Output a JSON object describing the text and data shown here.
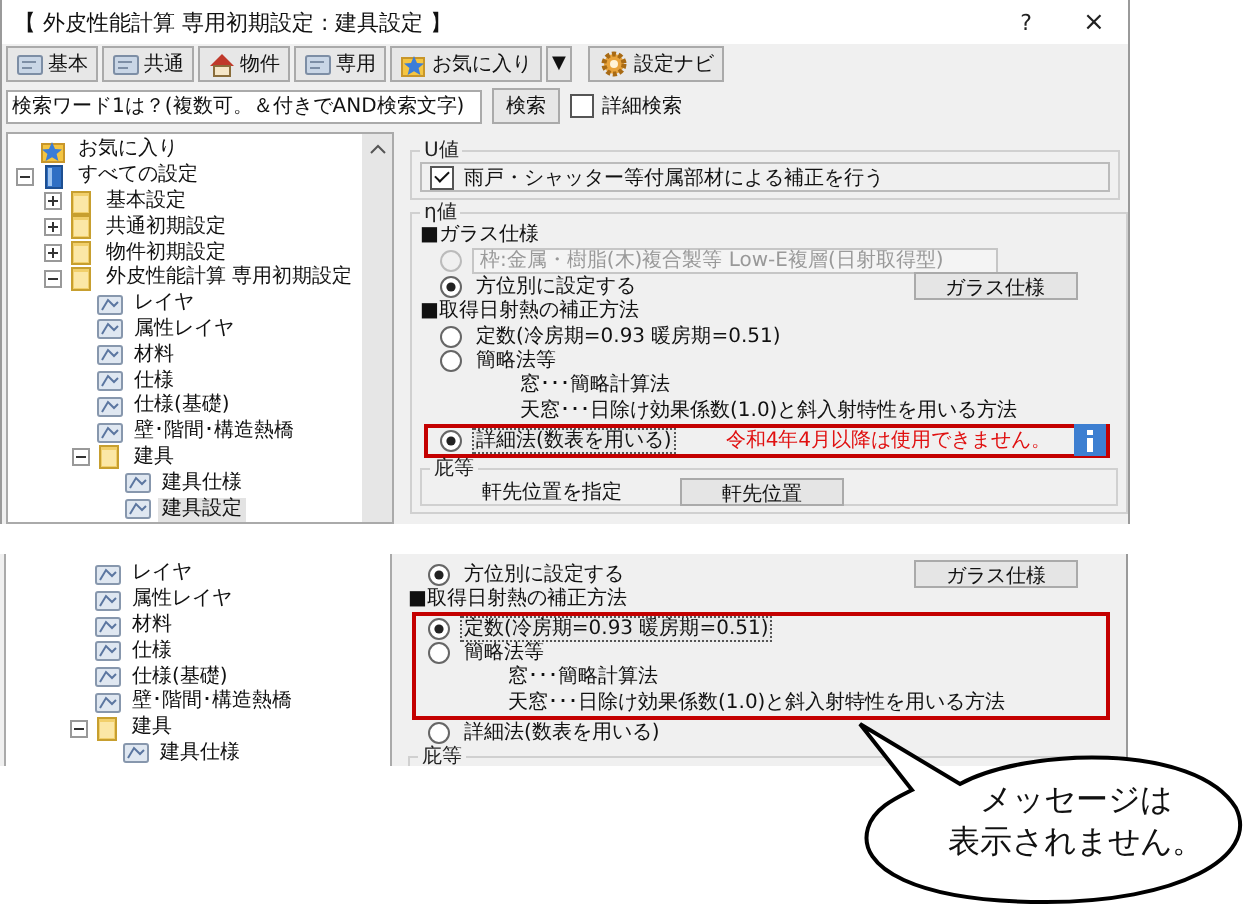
{
  "window": {
    "title": "【 外皮性能計算 専用初期設定 : 建具設定 】",
    "help": "?",
    "close": "×"
  },
  "toolbar": [
    {
      "label": "基本",
      "kind": "card"
    },
    {
      "label": "共通",
      "kind": "card"
    },
    {
      "label": "物件",
      "kind": "house"
    },
    {
      "label": "専用",
      "kind": "card"
    },
    {
      "label": "お気に入り",
      "kind": "star"
    }
  ],
  "toolbar_dropdown": "▼",
  "navi_button": "設定ナビ",
  "search": {
    "placeholder": "検索ワード1は？(複数可。＆付きでAND検索文字)",
    "button": "検索",
    "detail_checkbox": {
      "label": "詳細検索",
      "checked": false
    }
  },
  "tree": [
    {
      "label": "お気に入り",
      "kind": "favorite",
      "selected": false
    },
    {
      "label": "すべての設定",
      "kind": "root",
      "expanded": true,
      "selected": false,
      "children": [
        {
          "label": "基本設定",
          "kind": "folder",
          "expanded": false,
          "selected": false
        },
        {
          "label": "共通初期設定",
          "kind": "folder",
          "expanded": false,
          "selected": false
        },
        {
          "label": "物件初期設定",
          "kind": "folder",
          "expanded": false,
          "selected": false
        },
        {
          "label": "外皮性能計算 専用初期設定",
          "kind": "folder",
          "expanded": true,
          "selected": false,
          "children": [
            {
              "label": "レイヤ",
              "kind": "page",
              "selected": false
            },
            {
              "label": "属性レイヤ",
              "kind": "page",
              "selected": false
            },
            {
              "label": "材料",
              "kind": "page",
              "selected": false
            },
            {
              "label": "仕様",
              "kind": "page",
              "selected": false
            },
            {
              "label": "仕様(基礎)",
              "kind": "page",
              "selected": false
            },
            {
              "label": "壁･階間･構造熱橋",
              "kind": "page",
              "selected": false
            },
            {
              "label": "建具",
              "kind": "folder",
              "expanded": true,
              "selected": false,
              "children": [
                {
                  "label": "建具仕様",
                  "kind": "page",
                  "selected": false
                },
                {
                  "label": "建具設定",
                  "kind": "page",
                  "selected": true
                }
              ]
            }
          ]
        }
      ]
    }
  ],
  "settings": {
    "u_group": {
      "legend": "U値",
      "checkbox": {
        "label": "雨戸・シャッター等付属部材による補正を行う",
        "checked": true
      }
    },
    "eta_group": {
      "legend": "η値",
      "glass_heading": "■ガラス仕様",
      "glass_options": [
        {
          "label": "枠:金属・樹脂(木)複合製等 Low-E複層(日射取得型)",
          "kind": "field",
          "selected": false,
          "disabled": true
        },
        {
          "label": "方位別に設定する",
          "kind": "button",
          "button": "ガラス仕様",
          "selected": true,
          "disabled": false
        }
      ],
      "correction_heading": "■取得日射熱の補正方法",
      "correction_options": [
        {
          "label": "定数(冷房期=0.93 暖房期=0.51)",
          "selected": false,
          "focused": false,
          "highlighted": false
        },
        {
          "label": "簡略法等",
          "selected": false,
          "focused": false,
          "highlighted": false,
          "notes": [
            "窓･･･簡略計算法",
            "天窓･･･日除け効果係数(1.0)と斜入射特性を用いる方法"
          ]
        },
        {
          "label": "詳細法(数表を用いる)",
          "selected": true,
          "focused": true,
          "highlighted": true,
          "message": "令和4年4月以降は使用できません。"
        }
      ],
      "eaves_group": {
        "legend": "庇等",
        "label": "軒先位置を指定",
        "button": "軒先位置"
      }
    }
  },
  "second_view": {
    "tree": [
      {
        "label": "レイヤ",
        "kind": "page",
        "selected": false
      },
      {
        "label": "属性レイヤ",
        "kind": "page",
        "selected": false
      },
      {
        "label": "材料",
        "kind": "page",
        "selected": false
      },
      {
        "label": "仕様",
        "kind": "page",
        "selected": false
      },
      {
        "label": "仕様(基礎)",
        "kind": "page",
        "selected": false
      },
      {
        "label": "壁･階間･構造熱橋",
        "kind": "page",
        "selected": false
      },
      {
        "label": "建具",
        "kind": "folder",
        "expanded": true,
        "selected": false,
        "children": [
          {
            "label": "建具仕様",
            "kind": "page",
            "selected": false
          }
        ]
      }
    ],
    "settings": {
      "eta_group": {
        "glass_options": [
          {
            "label": "方位別に設定する",
            "kind": "button",
            "button": "ガラス仕様",
            "selected": true,
            "disabled": false
          }
        ],
        "correction_heading": "■取得日射熱の補正方法",
        "correction_options": [
          {
            "label": "定数(冷房期=0.93 暖房期=0.51)",
            "selected": true,
            "focused": true,
            "highlighted": true
          },
          {
            "label": "簡略法等",
            "selected": false,
            "focused": false,
            "highlighted": true,
            "notes": [
              "窓･･･簡略計算法",
              "天窓･･･日除け効果係数(1.0)と斜入射特性を用いる方法"
            ]
          },
          {
            "label": "詳細法(数表を用いる)",
            "selected": false,
            "focused": false,
            "highlighted": false
          }
        ],
        "eaves_group": {
          "legend": "庇等"
        }
      }
    }
  },
  "callout": [
    "メッセージは",
    "表示されません。"
  ]
}
